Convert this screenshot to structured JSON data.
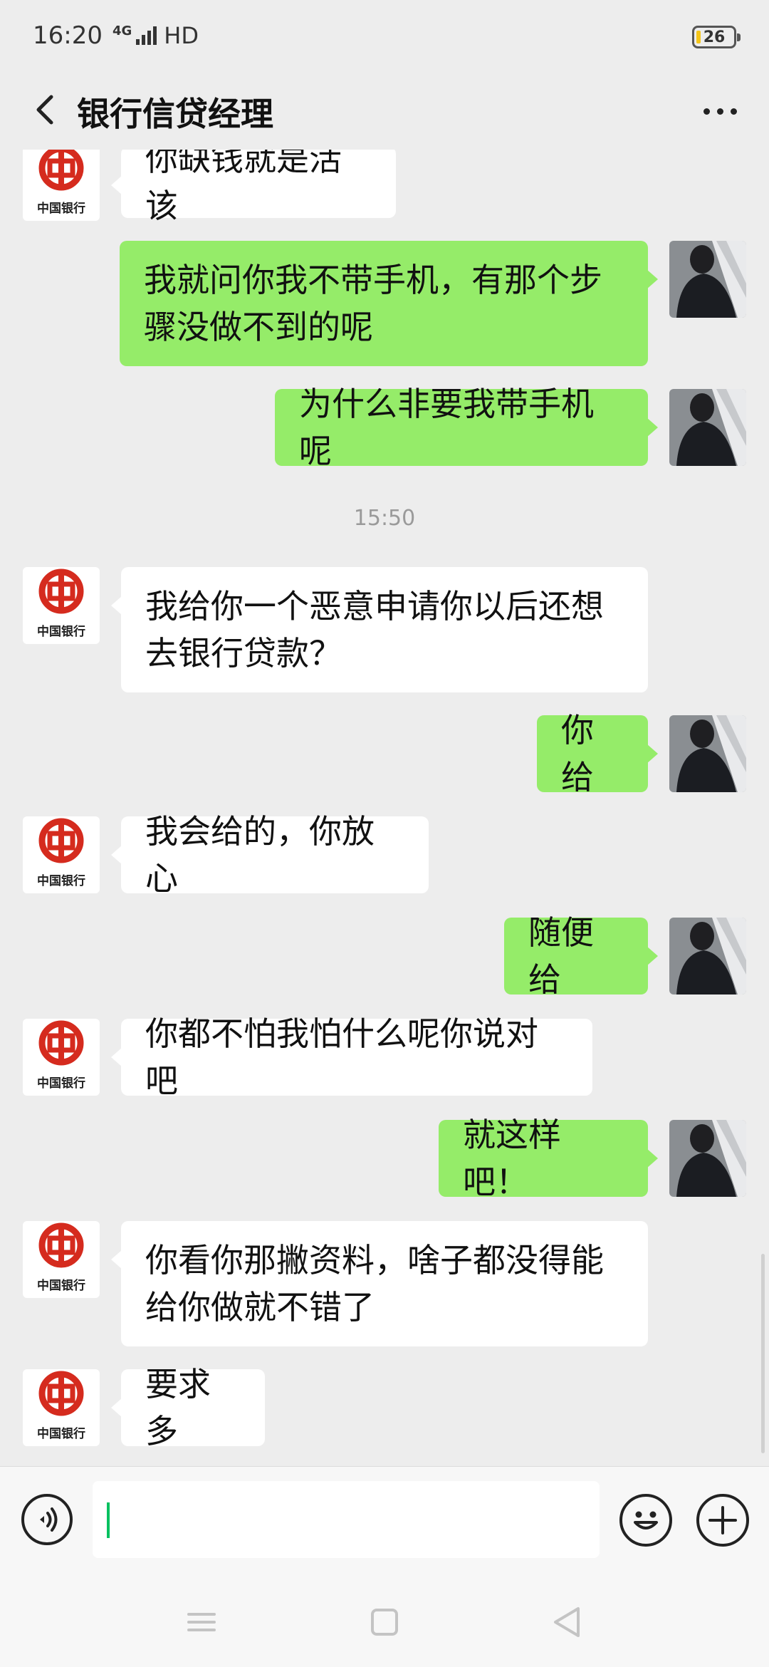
{
  "status_bar": {
    "time": "16:20",
    "network": "4G",
    "hd": "HD",
    "battery": "26",
    "icons": [
      "signal-icon",
      "battery-icon"
    ]
  },
  "header": {
    "title": "银行信贷经理",
    "icons": [
      "back-arrow-icon",
      "more-dots-icon"
    ]
  },
  "contact": {
    "avatar_text": "中国银行"
  },
  "messages": [
    {
      "from": "contact",
      "text": "你缺钱就是活该"
    },
    {
      "from": "me",
      "text": "我就问你我不带手机，有那个步骤没做不到的呢"
    },
    {
      "from": "me",
      "text": "为什么非要我带手机呢"
    },
    {
      "type": "timestamp",
      "text": "15:50"
    },
    {
      "from": "contact",
      "text": "我给你一个恶意申请你以后还想去银行贷款？"
    },
    {
      "from": "me",
      "text": "你给"
    },
    {
      "from": "contact",
      "text": "我会给的，你放心"
    },
    {
      "from": "me",
      "text": "随便给"
    },
    {
      "from": "contact",
      "text": "你都不怕我怕什么呢你说对吧"
    },
    {
      "from": "me",
      "text": "就这样吧！"
    },
    {
      "from": "contact",
      "text": "你看你那撇资料，啥子都没得能给你做就不错了"
    },
    {
      "from": "contact",
      "text": "要求多"
    }
  ],
  "input_bar": {
    "value": "",
    "icons": [
      "voice-icon",
      "emoji-icon",
      "plus-icon"
    ]
  },
  "nav_bar": {
    "icons": [
      "menu-icon",
      "home-icon",
      "back-icon"
    ]
  },
  "colors": {
    "background": "#ededed",
    "outgoing_bubble": "#95ec69",
    "incoming_bubble": "#ffffff",
    "boc_red": "#d52b1e",
    "caret": "#07c160"
  }
}
